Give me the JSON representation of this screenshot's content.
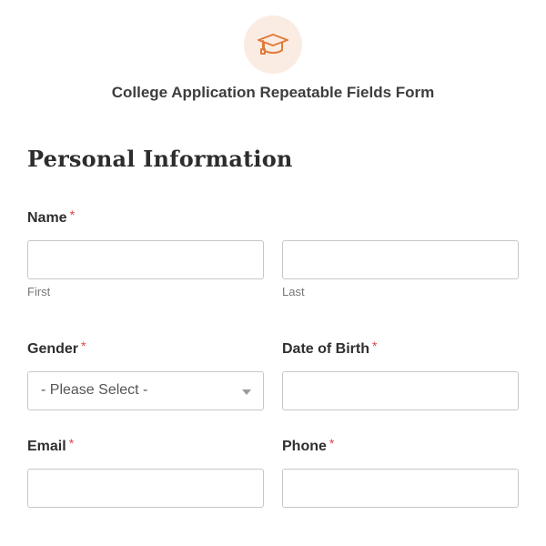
{
  "header": {
    "form_title": "College Application Repeatable Fields Form",
    "logo_icon": "graduation-cap-icon",
    "accent_color": "#e07b39"
  },
  "section": {
    "title": "Personal Information"
  },
  "fields": {
    "name": {
      "label": "Name",
      "required": "*",
      "first_sublabel": "First",
      "last_sublabel": "Last",
      "first_value": "",
      "last_value": ""
    },
    "gender": {
      "label": "Gender",
      "required": "*",
      "selected": "- Please Select -"
    },
    "dob": {
      "label": "Date of Birth",
      "required": "*",
      "value": ""
    },
    "email": {
      "label": "Email",
      "required": "*",
      "value": ""
    },
    "phone": {
      "label": "Phone",
      "required": "*",
      "value": ""
    }
  }
}
